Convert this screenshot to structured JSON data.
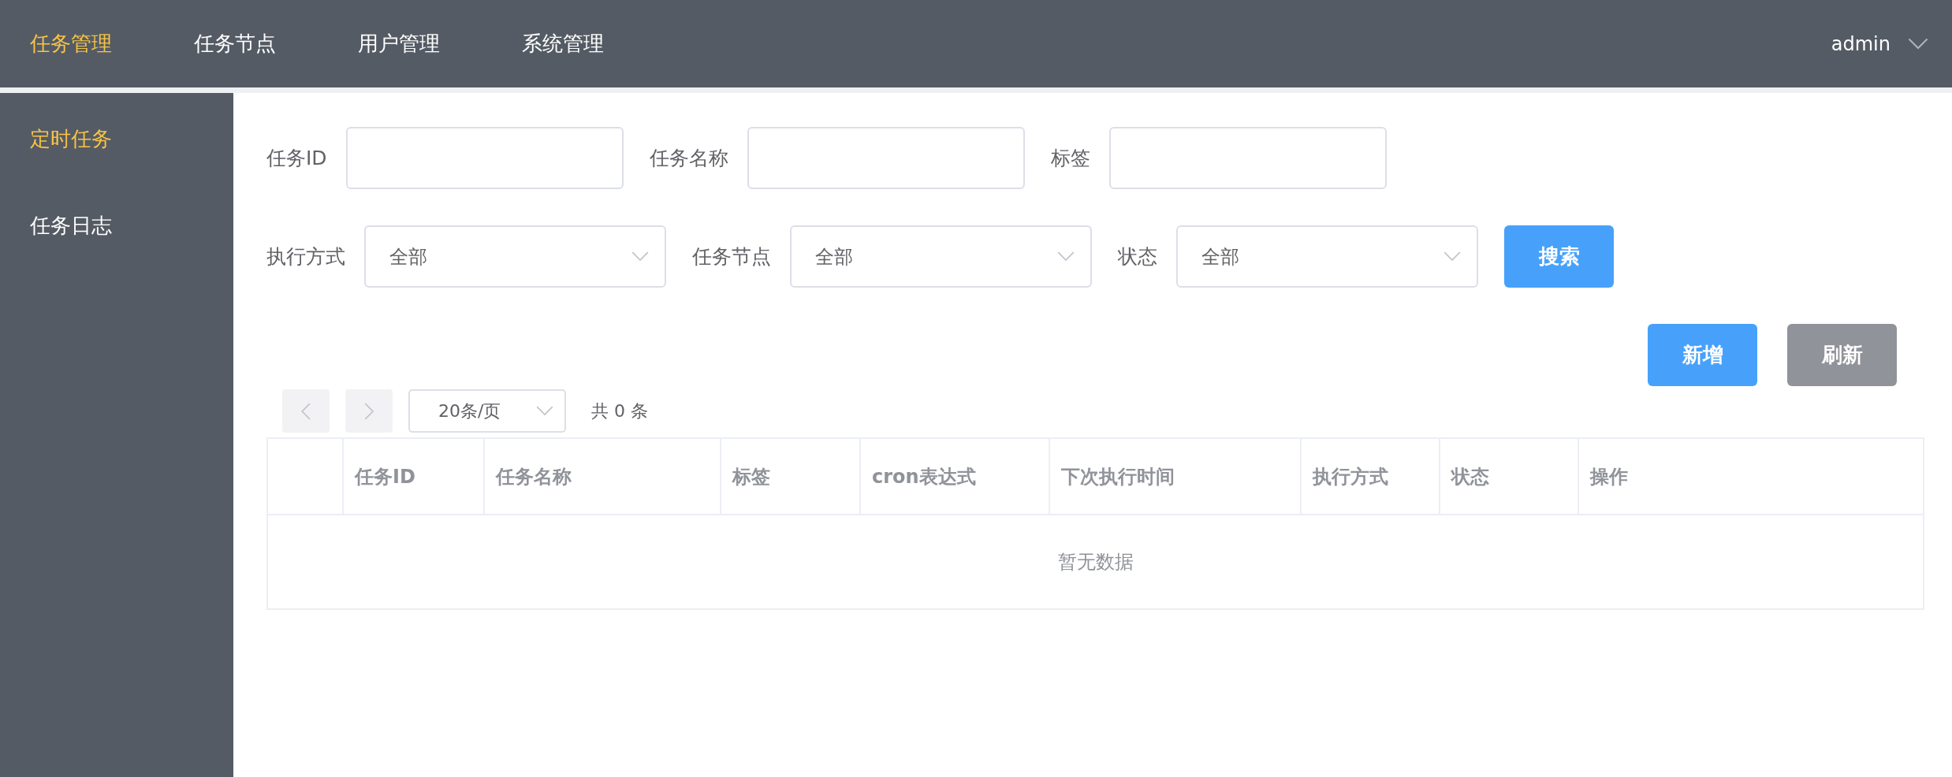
{
  "top_nav": {
    "items": [
      {
        "label": "任务管理",
        "selected": true
      },
      {
        "label": "任务节点",
        "selected": false
      },
      {
        "label": "用户管理",
        "selected": false
      },
      {
        "label": "系统管理",
        "selected": false
      }
    ],
    "user": "admin"
  },
  "sidebar": {
    "items": [
      {
        "label": "定时任务",
        "selected": true
      },
      {
        "label": "任务日志",
        "selected": false
      }
    ]
  },
  "filters": {
    "inputs": [
      {
        "label": "任务ID"
      },
      {
        "label": "任务名称"
      },
      {
        "label": "标签"
      }
    ],
    "selects": [
      {
        "label": "执行方式",
        "value": "全部"
      },
      {
        "label": "任务节点",
        "value": "全部"
      },
      {
        "label": "状态",
        "value": "全部"
      }
    ],
    "search_button": "搜索"
  },
  "actions": [
    {
      "label": "新增",
      "kind": "primary"
    },
    {
      "label": "刷新",
      "kind": "secondary"
    }
  ],
  "pagination": {
    "page_size": "20条/页",
    "total": "共 0 条"
  },
  "table": {
    "columns": [
      "",
      "任务ID",
      "任务名称",
      "标签",
      "cron表达式",
      "下次执行时间",
      "执行方式",
      "状态",
      "操作"
    ],
    "empty_text": "暂无数据"
  }
}
